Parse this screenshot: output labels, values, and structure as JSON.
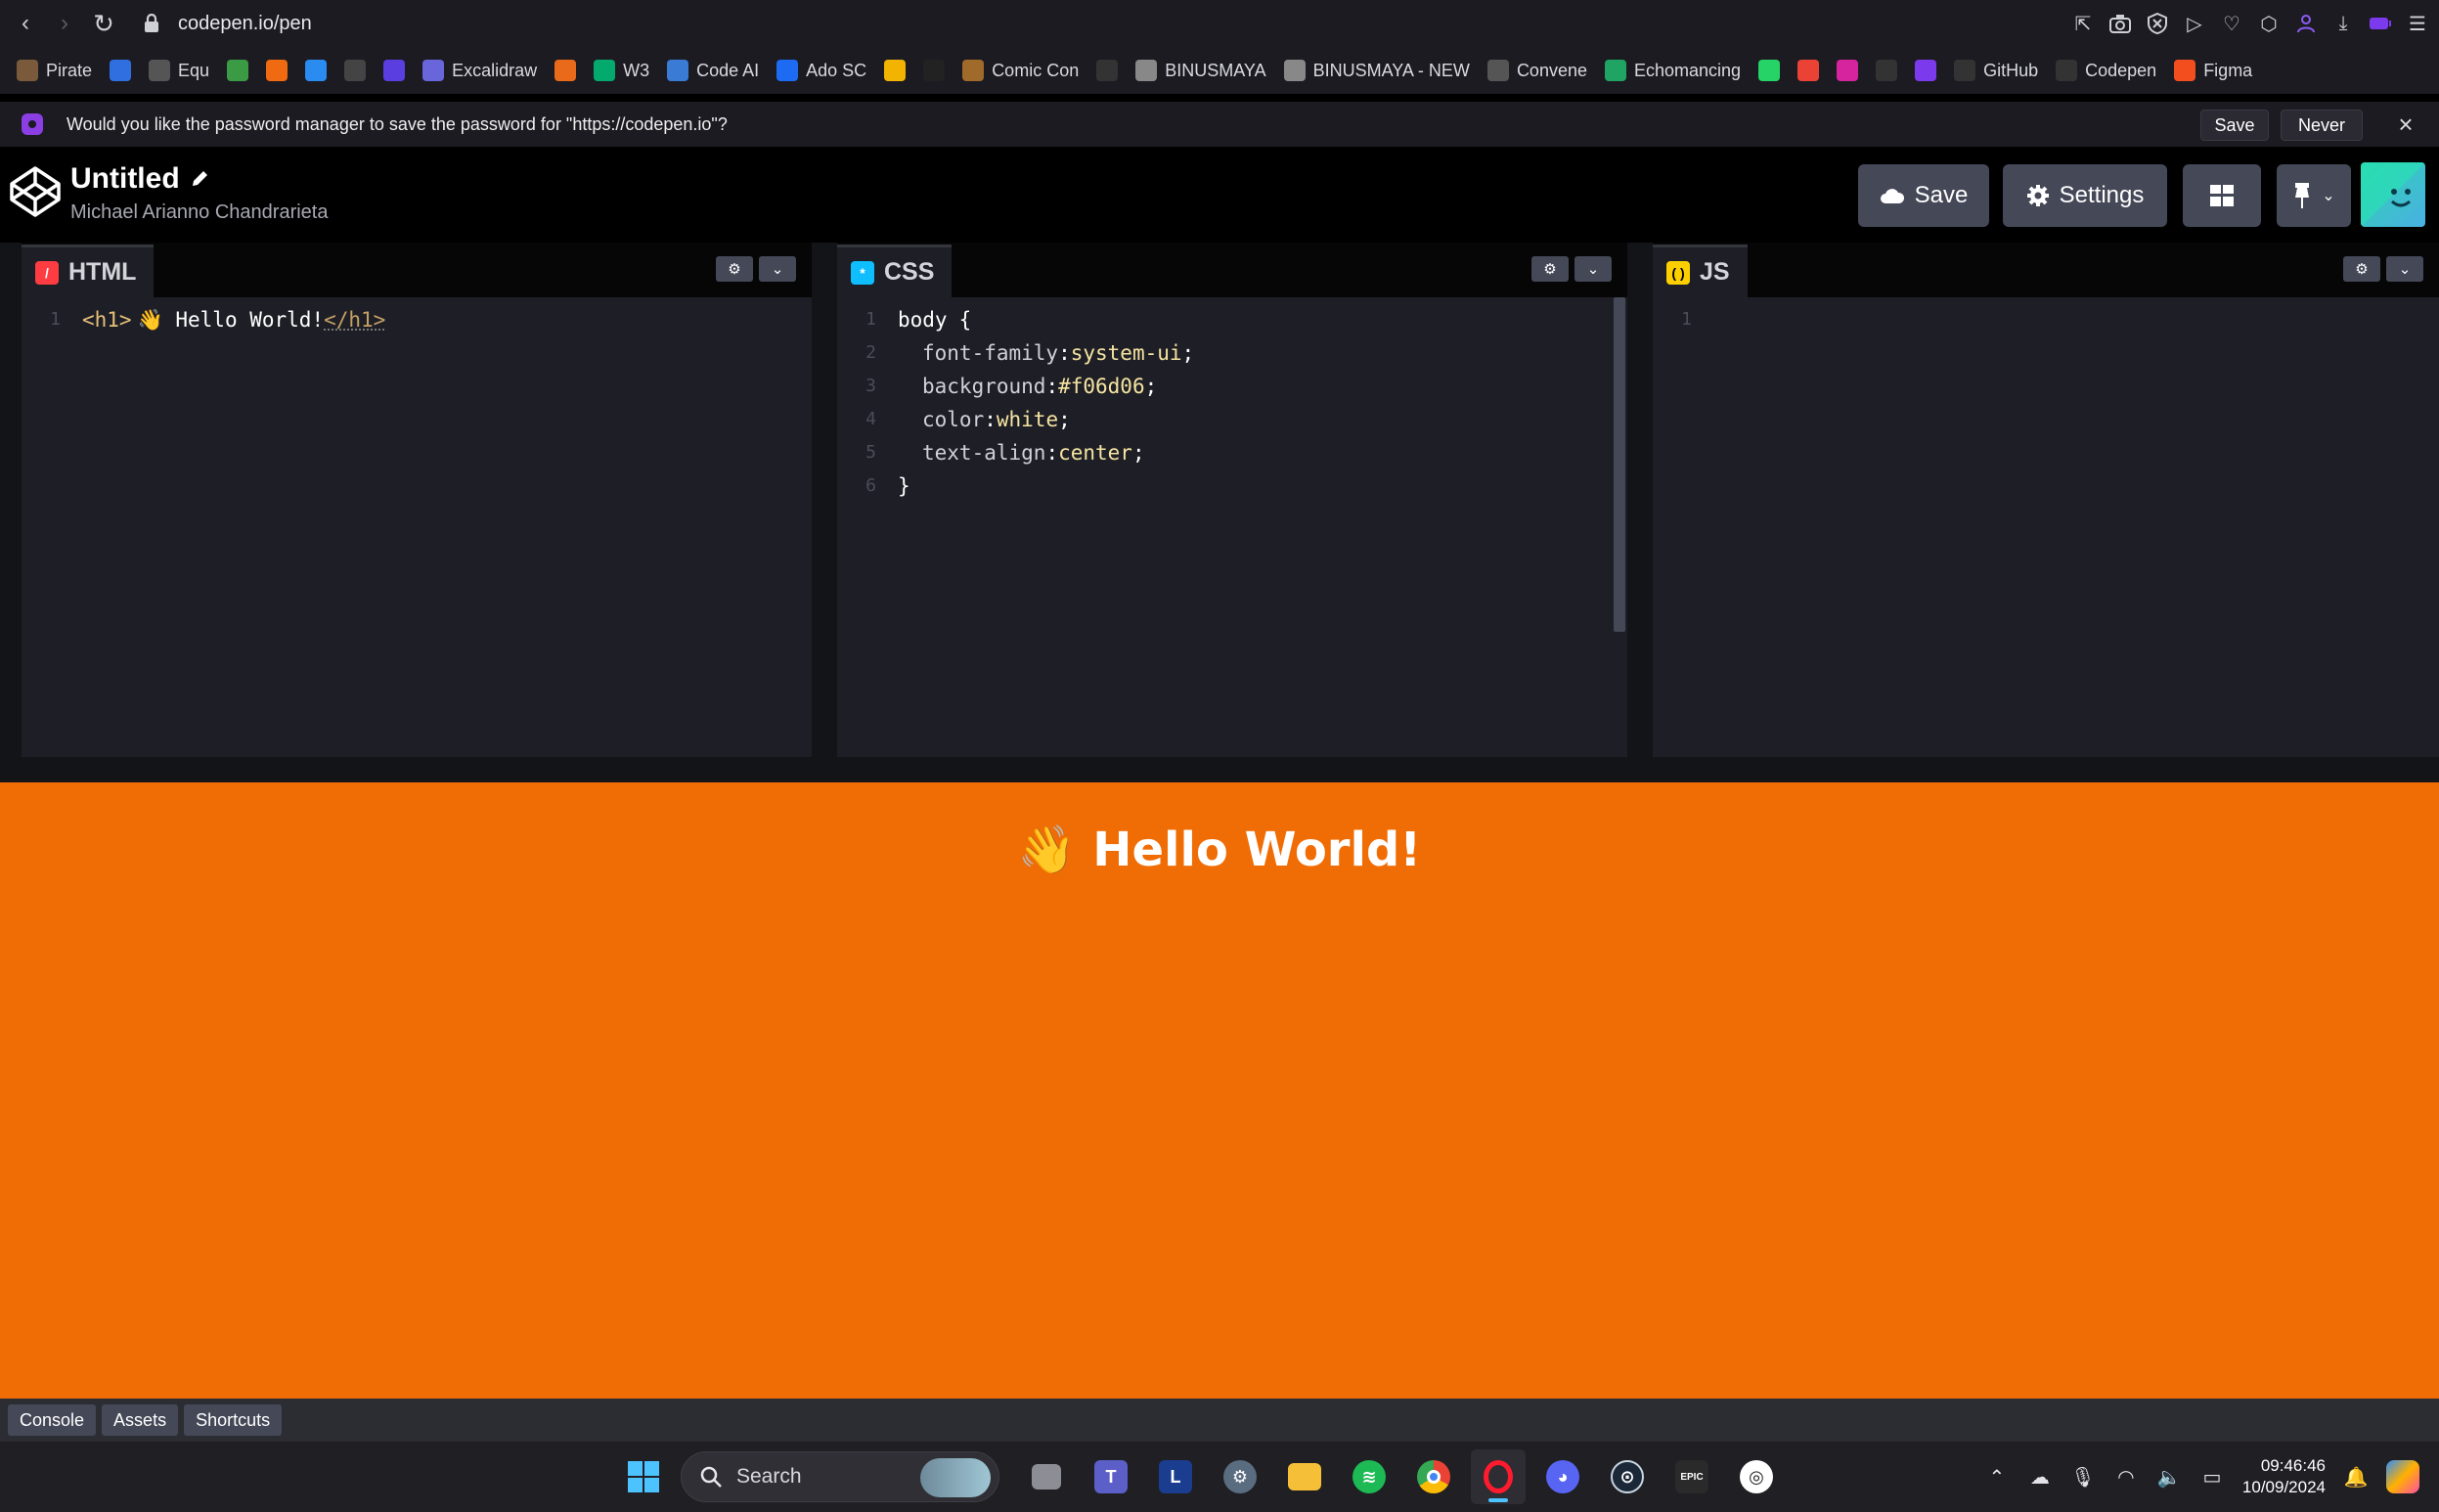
{
  "browser": {
    "url": "codepen.io/pen",
    "nav": {
      "back": "‹",
      "forward": "›",
      "reload": "↻"
    },
    "bookmarks": [
      {
        "label": "Pirate",
        "icon": "pirate-icon",
        "color": "#7a5a3a"
      },
      {
        "label": "",
        "icon": "d-icon",
        "color": "#2f6fe0"
      },
      {
        "label": "Equ",
        "icon": "gear-icon",
        "color": "#555"
      },
      {
        "label": "",
        "icon": "owl-icon",
        "color": "#3b9b45"
      },
      {
        "label": "",
        "icon": "u-icon",
        "color": "#ef6a10"
      },
      {
        "label": "",
        "icon": "bolt-icon",
        "color": "#2a8cf0"
      },
      {
        "label": "",
        "icon": "chatgpt-icon",
        "color": "#444"
      },
      {
        "label": "",
        "icon": "shield-icon",
        "color": "#5b3ee0"
      },
      {
        "label": "Excalidraw",
        "icon": "excalidraw-icon",
        "color": "#6965db"
      },
      {
        "label": "",
        "icon": "dots-icon",
        "color": "#e86a1a"
      },
      {
        "label": "W3",
        "icon": "w3-icon",
        "color": "#04aa6d"
      },
      {
        "label": "Code AI",
        "icon": "codeai-icon",
        "color": "#3a7bd5"
      },
      {
        "label": "Ado SC",
        "icon": "ado-icon",
        "color": "#1d6bf3"
      },
      {
        "label": "",
        "icon": "u2-icon",
        "color": "#f2b400"
      },
      {
        "label": "",
        "icon": "cai-icon",
        "color": "#222"
      },
      {
        "label": "Comic Con",
        "icon": "comic-icon",
        "color": "#a06a2a"
      },
      {
        "label": "",
        "icon": "notion-icon",
        "color": "#333"
      },
      {
        "label": "BINUSMAYA",
        "icon": "binus-icon",
        "color": "#888"
      },
      {
        "label": "BINUSMAYA - NEW",
        "icon": "binus-new-icon",
        "color": "#888"
      },
      {
        "label": "Convene",
        "icon": "convene-icon",
        "color": "#555"
      },
      {
        "label": "Echomancing",
        "icon": "sheets-icon",
        "color": "#1fa463"
      },
      {
        "label": "",
        "icon": "whatsapp-icon",
        "color": "#25d366"
      },
      {
        "label": "",
        "icon": "gmail-icon",
        "color": "#ea4335"
      },
      {
        "label": "",
        "icon": "instagram-icon",
        "color": "#d6249f"
      },
      {
        "label": "",
        "icon": "prompt-icon",
        "color": "#333"
      },
      {
        "label": "",
        "icon": "slash-icon",
        "color": "#7c3aed"
      },
      {
        "label": "GitHub",
        "icon": "github-icon",
        "color": "#333"
      },
      {
        "label": "Codepen",
        "icon": "codepen-icon",
        "color": "#333"
      },
      {
        "label": "Figma",
        "icon": "figma-icon",
        "color": "#f24e1e"
      }
    ],
    "password_prompt": {
      "text": "Would you like the password manager to save the password for \"https://codepen.io\"?",
      "save": "Save",
      "never": "Never",
      "close": "×"
    }
  },
  "codepen": {
    "title": "Untitled",
    "author": "Michael Arianno Chandrarieta",
    "save_label": "Save",
    "settings_label": "Settings",
    "panes": {
      "html": {
        "label": "HTML",
        "color": "#ff3c41"
      },
      "css": {
        "label": "CSS",
        "color": "#0ebeff"
      },
      "js": {
        "label": "JS",
        "color": "#fcd000"
      }
    },
    "html_code": {
      "line_numbers": [
        "1"
      ],
      "open_tag": "<h1>",
      "text": "👋 Hello World!",
      "close_tag": "</h1>"
    },
    "css_code": {
      "line_numbers": [
        "1",
        "2",
        "3",
        "4",
        "5",
        "6"
      ],
      "selector": "body",
      "open_brace": "{",
      "close_brace": "}",
      "rules": [
        {
          "prop": "font-family",
          "value": "system-ui"
        },
        {
          "prop": "background",
          "value": "#f06d06"
        },
        {
          "prop": "color",
          "value": "white"
        },
        {
          "prop": "text-align",
          "value": "center"
        }
      ]
    },
    "js_code": {
      "line_numbers": [
        "1"
      ]
    },
    "preview": {
      "heading": "👋 Hello World!",
      "background": "#f06d06"
    },
    "footer": {
      "console": "Console",
      "assets": "Assets",
      "shortcuts": "Shortcuts"
    }
  },
  "taskbar": {
    "search_label": "Search",
    "time": "09:46:46",
    "date": "10/09/2024",
    "apps": [
      "windows-start-icon",
      "task-view-icon",
      "teams-icon",
      "l-app-icon",
      "settings-icon",
      "file-explorer-icon",
      "spotify-icon",
      "chrome-icon",
      "opera-icon",
      "discord-icon",
      "steam-icon",
      "epic-games-icon",
      "ubisoft-icon"
    ]
  },
  "colors": {
    "codepen_button": "#444857",
    "editor_bg": "#1e1f26",
    "preview_bg": "#f06d06"
  }
}
